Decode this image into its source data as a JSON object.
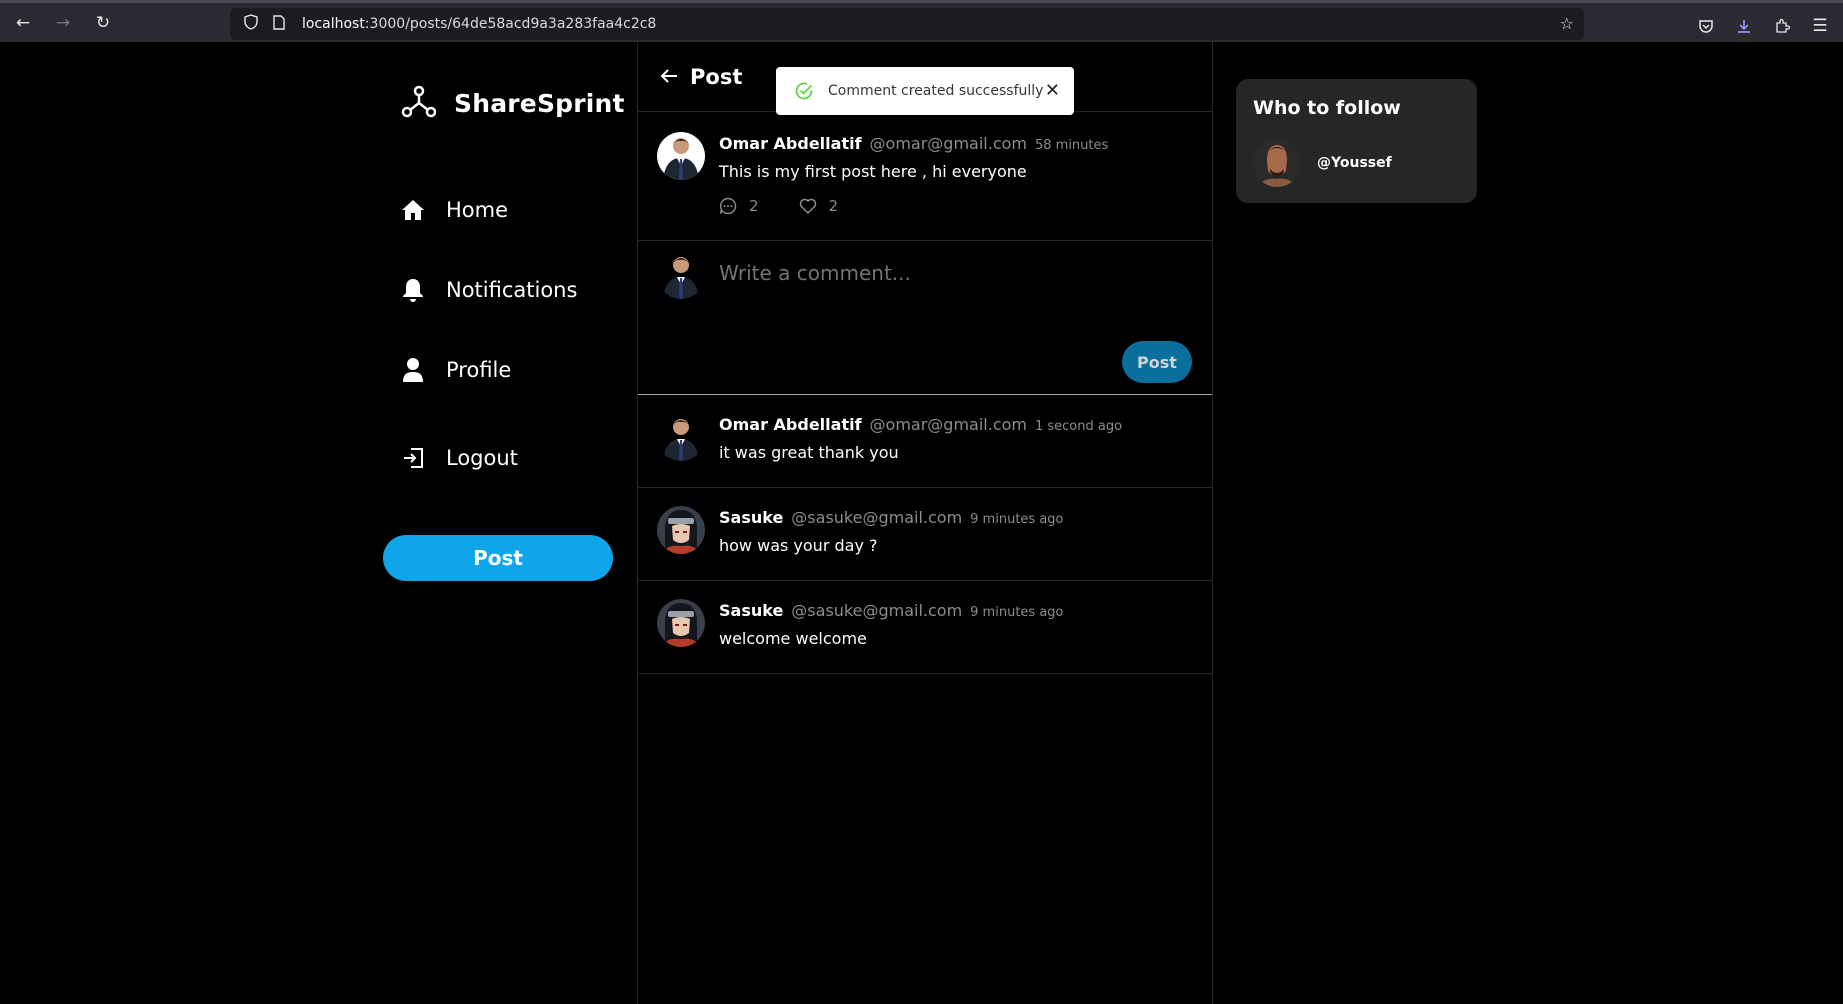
{
  "browser": {
    "url_host": "localhost",
    "url_path": ":3000/posts/64de58acd9a3a283faa4c2c8"
  },
  "sidebar": {
    "brand": "ShareSprint",
    "items": [
      {
        "label": "Home",
        "icon": "home-icon"
      },
      {
        "label": "Notifications",
        "icon": "bell-icon"
      },
      {
        "label": "Profile",
        "icon": "user-icon"
      },
      {
        "label": "Logout",
        "icon": "logout-icon"
      }
    ],
    "post_button": "Post"
  },
  "feed": {
    "header_title": "Post",
    "toast": "Comment created successfully",
    "post": {
      "name": "Omar Abdellatif",
      "handle": "@omar@gmail.com",
      "time": "58 minutes",
      "text": "This is my first post here , hi everyone",
      "comments": "2",
      "likes": "2"
    },
    "composer": {
      "placeholder": "Write a comment...",
      "button": "Post"
    },
    "comments": [
      {
        "name": "Omar Abdellatif",
        "handle": "@omar@gmail.com",
        "time": "1 second ago",
        "text": "it was great thank you"
      },
      {
        "name": "Sasuke",
        "handle": "@sasuke@gmail.com",
        "time": "9 minutes ago",
        "text": "how was your day ?"
      },
      {
        "name": "Sasuke",
        "handle": "@sasuke@gmail.com",
        "time": "9 minutes ago",
        "text": "welcome welcome"
      }
    ]
  },
  "follow": {
    "title": "Who to follow",
    "users": [
      {
        "name": "@Youssef"
      }
    ]
  },
  "colors": {
    "accent": "#0ea5e9",
    "background": "#000000",
    "card": "#262626",
    "toast_success": "#61d345"
  }
}
